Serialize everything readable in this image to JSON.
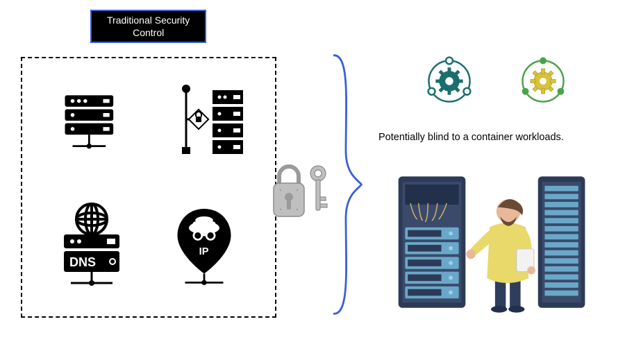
{
  "title": {
    "line1": "Traditional Security",
    "line2": "Control"
  },
  "dashed_box": {
    "icons": {
      "tl": "server-icon",
      "tr": "firewall-icon",
      "bl": "dns-server-icon",
      "br": "ip-location-pin-icon"
    },
    "labels": {
      "dns": "DNS",
      "ip": "IP"
    }
  },
  "lock": {
    "name": "padlock-icon"
  },
  "key": {
    "name": "key-icon"
  },
  "brace": {
    "color": "#3a5fd9"
  },
  "gears": {
    "left": {
      "name": "container-gear-teal",
      "ring": "#1c6e6e",
      "gear": "#1c6e6e",
      "dot": "#ffffff"
    },
    "right": {
      "name": "container-gear-green",
      "ring": "#4aa24a",
      "gear": "#d9c23a",
      "dot": "#4aa24a"
    }
  },
  "caption": "Potentially blind to a container workloads.",
  "admin_scene": {
    "name": "sysadmin-with-server-racks",
    "rack_color": "#3a4a6b",
    "rack_accent": "#6aa8c9",
    "person_shirt": "#e8d96a",
    "person_pants": "#2f3d5c"
  }
}
